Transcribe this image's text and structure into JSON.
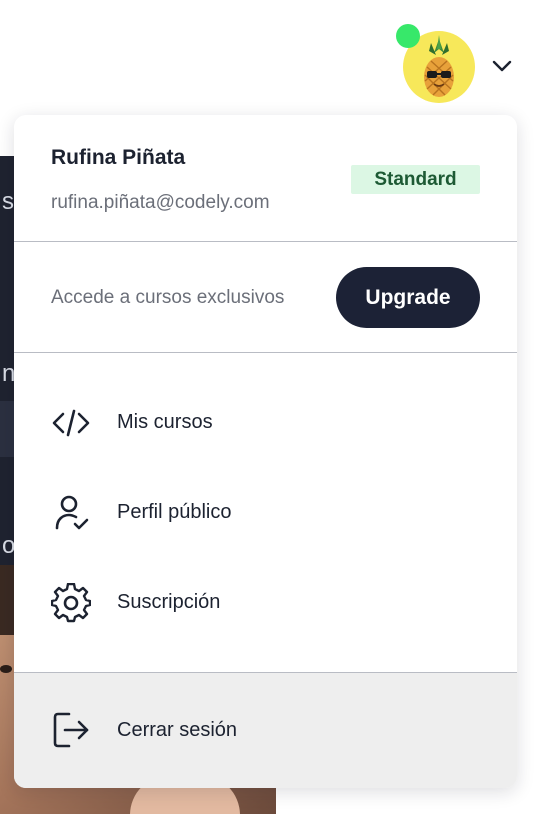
{
  "header": {
    "avatar_icon": "pineapple-avatar-icon",
    "status_color": "#37e86a",
    "avatar_bg": "#f7e85a",
    "dropdown_icon": "chevron-down-icon"
  },
  "background": {
    "side_letters": [
      "s",
      "n",
      "o"
    ]
  },
  "menu": {
    "user": {
      "name": "Rufina Piñata",
      "email": "rufina.piñata@codely.com",
      "plan": "Standard"
    },
    "upgrade": {
      "text": "Accede a cursos exclusivos",
      "button_label": "Upgrade"
    },
    "items": [
      {
        "label": "Mis cursos",
        "icon": "code-icon"
      },
      {
        "label": "Perfil público",
        "icon": "user-check-icon"
      },
      {
        "label": "Suscripción",
        "icon": "gear-icon"
      }
    ],
    "logout": {
      "label": "Cerrar sesión",
      "icon": "logout-icon"
    }
  },
  "colors": {
    "primary_dark": "#1c2236",
    "badge_bg": "#dcf7e4",
    "badge_text": "#1d5a34",
    "muted_text": "#6b6f79"
  }
}
